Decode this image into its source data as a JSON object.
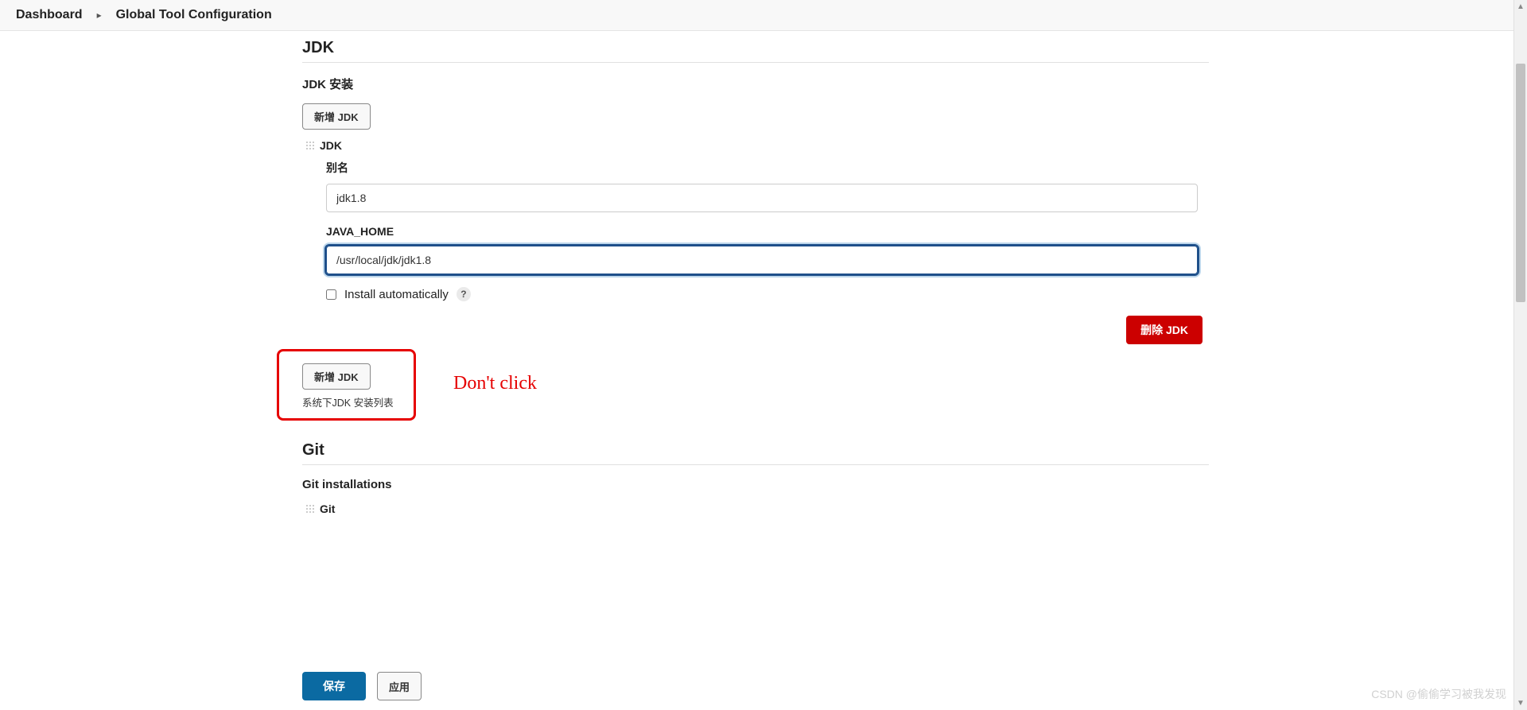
{
  "breadcrumb": {
    "items": [
      "Dashboard",
      "Global Tool Configuration"
    ]
  },
  "jdk": {
    "section_title": "JDK",
    "install_heading": "JDK 安装",
    "add_button": "新增 JDK",
    "install_name": "JDK",
    "alias_label": "别名",
    "alias_value": "jdk1.8",
    "java_home_label": "JAVA_HOME",
    "java_home_value": "/usr/local/jdk/jdk1.8",
    "install_auto_label": "Install automatically",
    "help": "?",
    "delete_button": "删除 JDK",
    "add_button_bottom": "新增 JDK",
    "list_help": "系统下JDK 安装列表"
  },
  "git": {
    "section_title": "Git",
    "install_heading": "Git installations",
    "install_name": "Git"
  },
  "footer": {
    "save": "保存",
    "apply": "应用"
  },
  "annotation": {
    "text": "Don't click"
  },
  "watermark": "CSDN @偷偷学习被我发现"
}
